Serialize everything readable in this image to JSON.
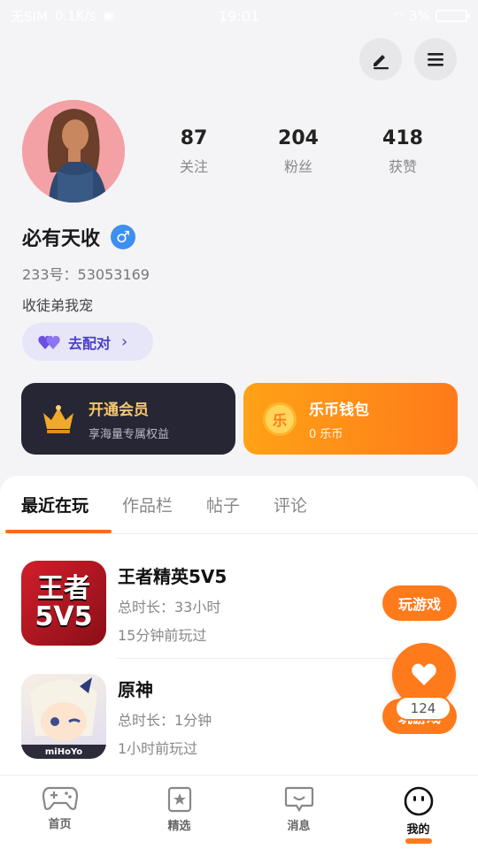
{
  "status_bar": {
    "carrier": "无SIM",
    "speed": "0.1K/s",
    "time": "19:01",
    "battery": "3%"
  },
  "profile": {
    "stats": [
      {
        "value": "87",
        "label": "关注"
      },
      {
        "value": "204",
        "label": "粉丝"
      },
      {
        "value": "418",
        "label": "获赞"
      }
    ],
    "username": "必有天收",
    "gender": "♂",
    "uid": "233号：53053169",
    "bio": "收徒弟我宠",
    "match_label": "去配对"
  },
  "cards": {
    "vip": {
      "title": "开通会员",
      "subtitle": "享海量专属权益"
    },
    "wallet": {
      "title": "乐币钱包",
      "subtitle": "0 乐币",
      "coin_char": "乐"
    }
  },
  "tabs": [
    "最近在玩",
    "作品栏",
    "帖子",
    "评论"
  ],
  "games": [
    {
      "name": "王者精英5V5",
      "duration": "总时长：33小时",
      "last_played": "15分钟前玩过",
      "button": "玩游戏",
      "icon_text_top": "王者",
      "icon_text_bottom": "5V5"
    },
    {
      "name": "原神",
      "duration": "总时长：1分钟",
      "last_played": "1小时前玩过",
      "button": "玩游戏",
      "icon_text": "miHoYo"
    }
  ],
  "like_count": "124",
  "nav": [
    {
      "label": "首页",
      "icon": "gamepad-icon"
    },
    {
      "label": "精选",
      "icon": "star-bookmark-icon"
    },
    {
      "label": "消息",
      "icon": "chat-bubble-icon"
    },
    {
      "label": "我的",
      "icon": "face-icon"
    }
  ],
  "colors": {
    "accent": "#ff7a1a",
    "vip_bg": "#262635",
    "gender": "#3d8ff0"
  }
}
